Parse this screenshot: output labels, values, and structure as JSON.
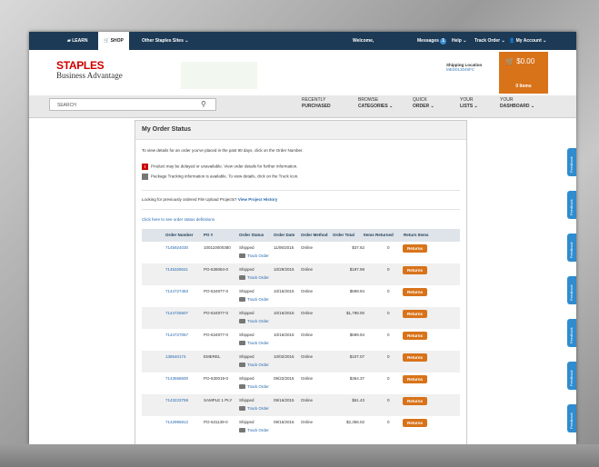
{
  "topnav": {
    "learn": "LEARN",
    "shop": "SHOP",
    "other_sites": "Other Staples Sites ⌄",
    "welcome": "Welcome,",
    "messages": "Messages",
    "messages_count": "1",
    "help": "Help ⌄",
    "track_order": "Track Order ⌄",
    "my_account": "My Account ⌄"
  },
  "header": {
    "logo_top": "STAPLES",
    "logo_bottom": "Business Advantage",
    "shipping_label": "Shipping Location",
    "shipping_code": "MED013049FC",
    "cart_amount": "$0.00",
    "cart_items": "0 Items"
  },
  "searchbar": {
    "placeholder": "SEARCH",
    "recently_1": "RECENTLY",
    "recently_2": "PURCHASED",
    "browse_1": "BROWSE",
    "browse_2": "CATEGORIES ⌄",
    "quick_1": "QUICK",
    "quick_2": "ORDER ⌄",
    "lists_1": "YOUR",
    "lists_2": "LISTS ⌄",
    "dash_1": "YOUR",
    "dash_2": "DASHBOARD ⌄"
  },
  "card": {
    "title": "My Order Status",
    "intro": "To view details for an order you've placed in the past 90 days, click on the Order Number.",
    "delay_note": "Product may be delayed or unavailable. View order details for further information.",
    "package_note": "Package Tracking information is available. To view details, click on the Truck icon.",
    "file_upload_q": "Looking for previously ordered File Upload Projects?",
    "file_upload_link": "View Project History",
    "definitions_link": "Click here to see order status definitions"
  },
  "table": {
    "headers": [
      "Order Number",
      "PO #",
      "Order Status",
      "Order Date",
      "Order Method",
      "Order Total",
      "Items Returned",
      "Return Items"
    ],
    "track_label": "Track Order",
    "return_label": "Returns",
    "rows": [
      {
        "order": "7145924030",
        "po": "100110000380",
        "status": "Shipped",
        "date": "11/06/2015",
        "method": "Online",
        "total": "$37.62",
        "returned": "0"
      },
      {
        "order": "7145326041",
        "po": "PO-636084-0",
        "status": "Shipped",
        "date": "10/29/2015",
        "method": "Online",
        "total": "$197.98",
        "returned": "0"
      },
      {
        "order": "7144727483",
        "po": "PO-634977-0",
        "status": "Shipped",
        "date": "10/16/2015",
        "method": "Online",
        "total": "$699.94",
        "returned": "0"
      },
      {
        "order": "7144725607",
        "po": "PO-634977-0",
        "status": "Shipped",
        "date": "10/16/2015",
        "method": "Online",
        "total": "$1,798.00",
        "returned": "0"
      },
      {
        "order": "7144727067",
        "po": "PO-634977-0",
        "status": "Shipped",
        "date": "10/16/2015",
        "method": "Online",
        "total": "$699.94",
        "returned": "0"
      },
      {
        "order": "138540174",
        "po": "EMEREL",
        "status": "Shipped",
        "date": "10/02/2015",
        "method": "Online",
        "total": "$107.07",
        "returned": "0"
      },
      {
        "order": "7143568600",
        "po": "PO-630019-0",
        "status": "Shipped",
        "date": "09/22/2015",
        "method": "Online",
        "total": "$364.37",
        "returned": "0"
      },
      {
        "order": "7143223759",
        "po": "SAMPLE 1 PLY",
        "status": "Shipped",
        "date": "09/16/2015",
        "method": "Online",
        "total": "$61.43",
        "returned": "0"
      },
      {
        "order": "7142995812",
        "po": "PO-631139-0",
        "status": "Shipped",
        "date": "09/15/2015",
        "method": "Online",
        "total": "$2,356.02",
        "returned": "0"
      }
    ]
  },
  "feedback": {
    "label": "Feedback"
  },
  "colors": {
    "nav": "#1c3a55",
    "accent": "#d8731a",
    "brand_red": "#cc0000",
    "link": "#2668b0",
    "feedback": "#2f8ccf"
  }
}
